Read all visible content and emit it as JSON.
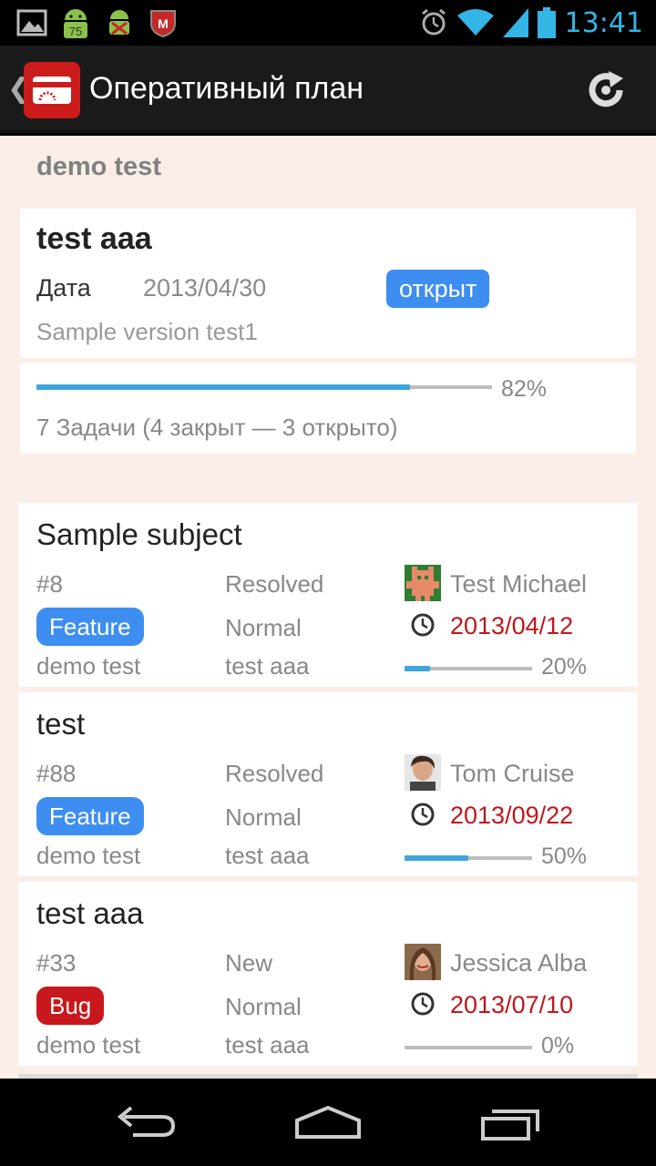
{
  "status_bar": {
    "time": "13:41",
    "battery_badge": "75",
    "icons": [
      "image-icon",
      "android-update-icon",
      "android-debug-icon",
      "mcafee-icon",
      "alarm-icon",
      "wifi-icon",
      "signal-icon",
      "battery-icon"
    ]
  },
  "action_bar": {
    "title": "Оперативный план",
    "icons": [
      "back-icon",
      "app-logo-icon",
      "refresh-icon"
    ]
  },
  "project": {
    "name": "demo test"
  },
  "version": {
    "name": "test aaa",
    "date_label": "Дата",
    "date": "2013/04/30",
    "status": "открыт",
    "description": "Sample version test1",
    "progress": 0.82,
    "progress_label": "82%",
    "tasks_summary": "7 Задачи (4 закрыт — 3 открыто)"
  },
  "issues": [
    {
      "subject": "Sample subject",
      "number": "#8",
      "status": "Resolved",
      "assignee": "Test Michael",
      "tracker": "Feature",
      "tracker_color": "#3d8ef0",
      "priority": "Normal",
      "due_date": "2013/04/12",
      "project": "demo test",
      "version": "test aaa",
      "progress": 0.2,
      "progress_label": "20%"
    },
    {
      "subject": "test",
      "number": "#88",
      "status": "Resolved",
      "assignee": "Tom Cruise",
      "tracker": "Feature",
      "tracker_color": "#3d8ef0",
      "priority": "Normal",
      "due_date": "2013/09/22",
      "project": "demo test",
      "version": "test aaa",
      "progress": 0.5,
      "progress_label": "50%"
    },
    {
      "subject": "test aaa",
      "number": "#33",
      "status": "New",
      "assignee": "Jessica Alba",
      "tracker": "Bug",
      "tracker_color": "#c8181d",
      "priority": "Normal",
      "due_date": "2013/07/10",
      "project": "demo test",
      "version": "test aaa",
      "progress": 0,
      "progress_label": "0%"
    }
  ],
  "colors": {
    "accent": "#33b5e5",
    "progress": "#3fa6dd",
    "due_date": "#c0161b",
    "background": "#fbede8"
  }
}
